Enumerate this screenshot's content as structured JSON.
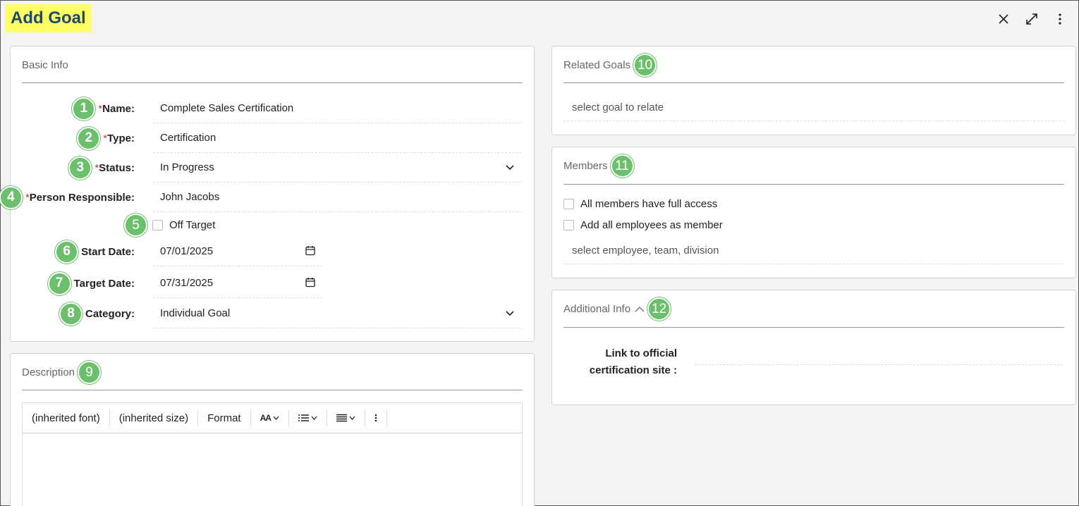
{
  "header": {
    "title": "Add Goal",
    "icons": [
      "close-icon",
      "expand-icon",
      "more-vertical-icon"
    ]
  },
  "basic_info": {
    "title": "Basic Info",
    "fields": [
      {
        "badge": "1",
        "label": "Name:",
        "required": "*",
        "value": "Complete Sales Certification"
      },
      {
        "badge": "2",
        "label": "Type:",
        "required": "*",
        "value": "Certification"
      },
      {
        "badge": "3",
        "label": "Status:",
        "required": "*",
        "value": "In Progress"
      },
      {
        "badge": "4",
        "label": "Person Responsible:",
        "required": "*",
        "value": "John Jacobs"
      },
      {
        "badge": "5",
        "label": "Off Target",
        "checked": false
      },
      {
        "badge": "6",
        "label": "Start Date:",
        "value": "07/01/2025"
      },
      {
        "badge": "7",
        "label": "Target Date:",
        "value": "07/31/2025"
      },
      {
        "badge": "8",
        "label": "Category:",
        "value": "Individual Goal"
      }
    ]
  },
  "description": {
    "title": "Description",
    "badge": "9",
    "toolbar": {
      "font": "(inherited font)",
      "size": "(inherited size)",
      "format": "Format",
      "text_size_icon": "AA"
    }
  },
  "related_goals": {
    "title": "Related Goals",
    "badge": "10",
    "placeholder": "select goal to relate"
  },
  "members": {
    "title": "Members",
    "badge": "11",
    "full_access_label": "All members have full access",
    "all_employees_label": "Add all employees as member",
    "placeholder": "select employee, team, division"
  },
  "additional_info": {
    "title": "Additional Info",
    "badge": "12",
    "link_label_line1": "Link to official",
    "link_label_line2": "certification site :"
  },
  "colors": {
    "badge": "#6cbf6c",
    "title_highlight": "#ffff66",
    "title_text": "#1c4a6b",
    "required": "#c0392b"
  }
}
